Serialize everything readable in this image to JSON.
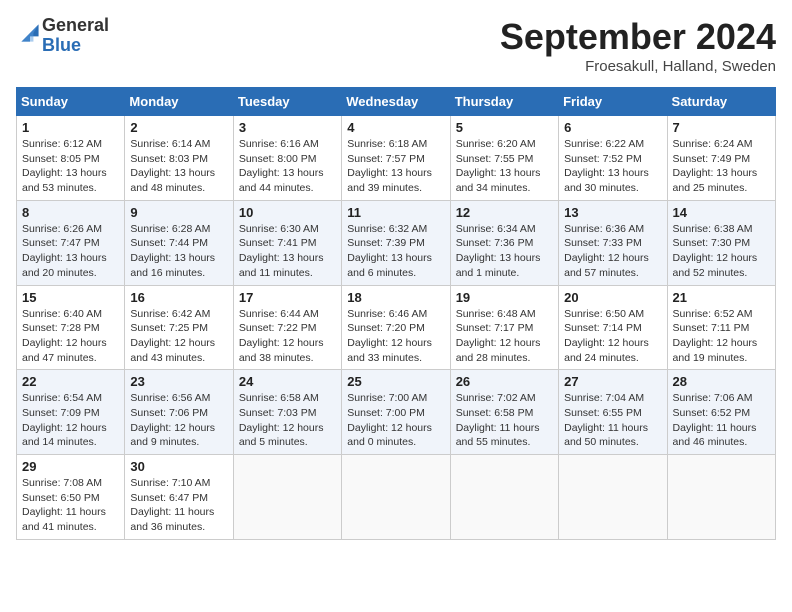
{
  "header": {
    "logo_general": "General",
    "logo_blue": "Blue",
    "title": "September 2024",
    "location": "Froesakull, Halland, Sweden"
  },
  "columns": [
    "Sunday",
    "Monday",
    "Tuesday",
    "Wednesday",
    "Thursday",
    "Friday",
    "Saturday"
  ],
  "weeks": [
    [
      {
        "day": "1",
        "info": "Sunrise: 6:12 AM\nSunset: 8:05 PM\nDaylight: 13 hours\nand 53 minutes."
      },
      {
        "day": "2",
        "info": "Sunrise: 6:14 AM\nSunset: 8:03 PM\nDaylight: 13 hours\nand 48 minutes."
      },
      {
        "day": "3",
        "info": "Sunrise: 6:16 AM\nSunset: 8:00 PM\nDaylight: 13 hours\nand 44 minutes."
      },
      {
        "day": "4",
        "info": "Sunrise: 6:18 AM\nSunset: 7:57 PM\nDaylight: 13 hours\nand 39 minutes."
      },
      {
        "day": "5",
        "info": "Sunrise: 6:20 AM\nSunset: 7:55 PM\nDaylight: 13 hours\nand 34 minutes."
      },
      {
        "day": "6",
        "info": "Sunrise: 6:22 AM\nSunset: 7:52 PM\nDaylight: 13 hours\nand 30 minutes."
      },
      {
        "day": "7",
        "info": "Sunrise: 6:24 AM\nSunset: 7:49 PM\nDaylight: 13 hours\nand 25 minutes."
      }
    ],
    [
      {
        "day": "8",
        "info": "Sunrise: 6:26 AM\nSunset: 7:47 PM\nDaylight: 13 hours\nand 20 minutes."
      },
      {
        "day": "9",
        "info": "Sunrise: 6:28 AM\nSunset: 7:44 PM\nDaylight: 13 hours\nand 16 minutes."
      },
      {
        "day": "10",
        "info": "Sunrise: 6:30 AM\nSunset: 7:41 PM\nDaylight: 13 hours\nand 11 minutes."
      },
      {
        "day": "11",
        "info": "Sunrise: 6:32 AM\nSunset: 7:39 PM\nDaylight: 13 hours\nand 6 minutes."
      },
      {
        "day": "12",
        "info": "Sunrise: 6:34 AM\nSunset: 7:36 PM\nDaylight: 13 hours\nand 1 minute."
      },
      {
        "day": "13",
        "info": "Sunrise: 6:36 AM\nSunset: 7:33 PM\nDaylight: 12 hours\nand 57 minutes."
      },
      {
        "day": "14",
        "info": "Sunrise: 6:38 AM\nSunset: 7:30 PM\nDaylight: 12 hours\nand 52 minutes."
      }
    ],
    [
      {
        "day": "15",
        "info": "Sunrise: 6:40 AM\nSunset: 7:28 PM\nDaylight: 12 hours\nand 47 minutes."
      },
      {
        "day": "16",
        "info": "Sunrise: 6:42 AM\nSunset: 7:25 PM\nDaylight: 12 hours\nand 43 minutes."
      },
      {
        "day": "17",
        "info": "Sunrise: 6:44 AM\nSunset: 7:22 PM\nDaylight: 12 hours\nand 38 minutes."
      },
      {
        "day": "18",
        "info": "Sunrise: 6:46 AM\nSunset: 7:20 PM\nDaylight: 12 hours\nand 33 minutes."
      },
      {
        "day": "19",
        "info": "Sunrise: 6:48 AM\nSunset: 7:17 PM\nDaylight: 12 hours\nand 28 minutes."
      },
      {
        "day": "20",
        "info": "Sunrise: 6:50 AM\nSunset: 7:14 PM\nDaylight: 12 hours\nand 24 minutes."
      },
      {
        "day": "21",
        "info": "Sunrise: 6:52 AM\nSunset: 7:11 PM\nDaylight: 12 hours\nand 19 minutes."
      }
    ],
    [
      {
        "day": "22",
        "info": "Sunrise: 6:54 AM\nSunset: 7:09 PM\nDaylight: 12 hours\nand 14 minutes."
      },
      {
        "day": "23",
        "info": "Sunrise: 6:56 AM\nSunset: 7:06 PM\nDaylight: 12 hours\nand 9 minutes."
      },
      {
        "day": "24",
        "info": "Sunrise: 6:58 AM\nSunset: 7:03 PM\nDaylight: 12 hours\nand 5 minutes."
      },
      {
        "day": "25",
        "info": "Sunrise: 7:00 AM\nSunset: 7:00 PM\nDaylight: 12 hours\nand 0 minutes."
      },
      {
        "day": "26",
        "info": "Sunrise: 7:02 AM\nSunset: 6:58 PM\nDaylight: 11 hours\nand 55 minutes."
      },
      {
        "day": "27",
        "info": "Sunrise: 7:04 AM\nSunset: 6:55 PM\nDaylight: 11 hours\nand 50 minutes."
      },
      {
        "day": "28",
        "info": "Sunrise: 7:06 AM\nSunset: 6:52 PM\nDaylight: 11 hours\nand 46 minutes."
      }
    ],
    [
      {
        "day": "29",
        "info": "Sunrise: 7:08 AM\nSunset: 6:50 PM\nDaylight: 11 hours\nand 41 minutes."
      },
      {
        "day": "30",
        "info": "Sunrise: 7:10 AM\nSunset: 6:47 PM\nDaylight: 11 hours\nand 36 minutes."
      },
      {
        "day": "",
        "info": ""
      },
      {
        "day": "",
        "info": ""
      },
      {
        "day": "",
        "info": ""
      },
      {
        "day": "",
        "info": ""
      },
      {
        "day": "",
        "info": ""
      }
    ]
  ]
}
